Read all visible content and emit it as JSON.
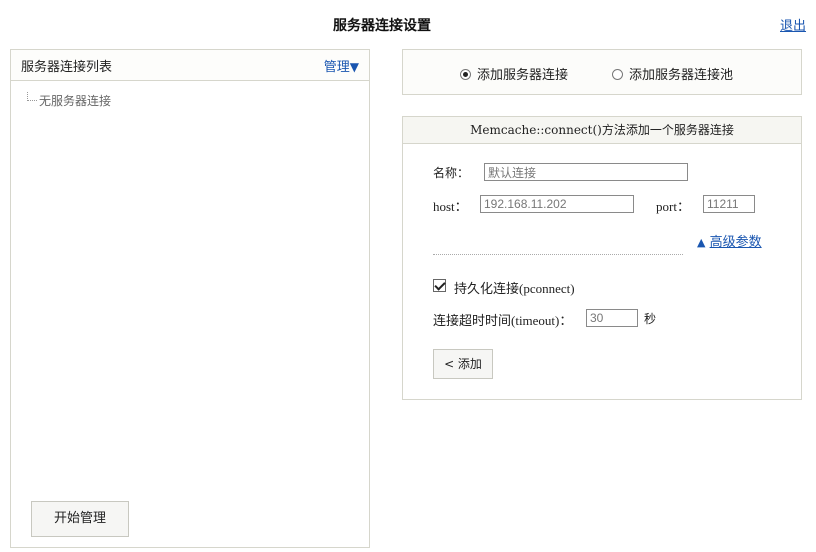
{
  "header": {
    "title": "服务器连接设置",
    "logout": "退出"
  },
  "left_panel": {
    "title": "服务器连接列表",
    "manage": "管理",
    "manage_arrow": "▼",
    "empty_item": "无服务器连接",
    "start_button": "开始管理"
  },
  "mode": {
    "options": [
      {
        "label": "添加服务器连接",
        "checked": true
      },
      {
        "label": "添加服务器连接池",
        "checked": false
      }
    ]
  },
  "form": {
    "header": "Memcache::connect()方法添加一个服务器连接",
    "name_label": "名称：",
    "name_value": "默认连接",
    "host_label": "host：",
    "host_value": "192.168.11.202",
    "port_label": "port：",
    "port_value": "11211",
    "advanced_icon": "▲",
    "advanced_link": "高级参数",
    "persistent_checked": true,
    "persistent_label": "持久化连接(pconnect)",
    "timeout_label": "连接超时时间(timeout)：",
    "timeout_value": "30",
    "timeout_unit": "秒",
    "add_button": "< 添加"
  },
  "colors": {
    "link": "#1a56b0",
    "border": "#d6d6cc"
  }
}
